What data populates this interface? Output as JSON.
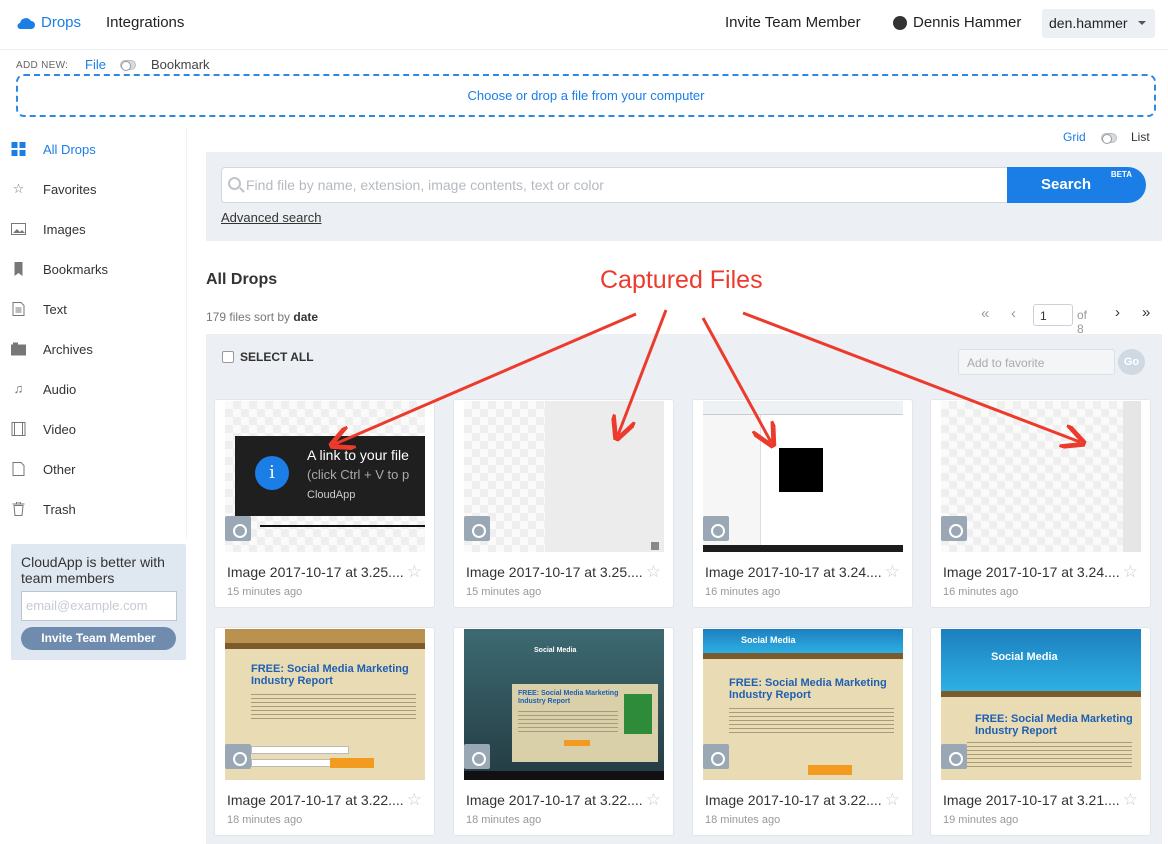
{
  "header": {
    "logo_label": "Drops",
    "nav_integrations": "Integrations",
    "invite_label": "Invite Team Member",
    "user_name": "Dennis Hammer",
    "account_label": "den.hammer"
  },
  "add_new": {
    "label": "ADD NEW:",
    "file_label": "File",
    "bookmark_label": "Bookmark",
    "dropzone_text": "Choose or drop a file from your computer"
  },
  "sidebar": {
    "items": [
      {
        "label": "All Drops",
        "icon": "grid-icon",
        "active": true
      },
      {
        "label": "Favorites",
        "icon": "star-icon"
      },
      {
        "label": "Images",
        "icon": "image-icon"
      },
      {
        "label": "Bookmarks",
        "icon": "bookmark-icon"
      },
      {
        "label": "Text",
        "icon": "text-file-icon"
      },
      {
        "label": "Archives",
        "icon": "archive-icon"
      },
      {
        "label": "Audio",
        "icon": "music-icon"
      },
      {
        "label": "Video",
        "icon": "film-icon"
      },
      {
        "label": "Other",
        "icon": "file-icon"
      },
      {
        "label": "Trash",
        "icon": "trash-icon"
      }
    ],
    "promo_text": "CloudApp is better with team members",
    "promo_email_placeholder": "email@example.com",
    "promo_button": "Invite Team Member"
  },
  "view": {
    "grid_label": "Grid",
    "list_label": "List"
  },
  "search": {
    "placeholder": "Find file by name, extension, image contents, text or color",
    "button_label": "Search",
    "badge": "BETA",
    "advanced_link": "Advanced search"
  },
  "main": {
    "title": "All Drops",
    "count_text": "179 files sort by",
    "sort_value": "date",
    "annotation": "Captured Files",
    "select_all": "SELECT ALL",
    "favorite_placeholder": "Add to favorite",
    "go_label": "Go"
  },
  "pagination": {
    "first": "«",
    "prev": "‹",
    "page": "1",
    "of_text": "of 8",
    "next": "›",
    "last": "»"
  },
  "toast": {
    "title": "A link to your file",
    "subtitle": "(click Ctrl + V to p",
    "app": "CloudApp"
  },
  "files": [
    {
      "name": "Image 2017-10-17 at 3.25....",
      "time": "15 minutes ago"
    },
    {
      "name": "Image 2017-10-17 at 3.25....",
      "time": "15 minutes ago"
    },
    {
      "name": "Image 2017-10-17 at 3.24....",
      "time": "16 minutes ago"
    },
    {
      "name": "Image 2017-10-17 at 3.24....",
      "time": "16 minutes ago"
    },
    {
      "name": "Image 2017-10-17 at 3.22....",
      "time": "18 minutes ago"
    },
    {
      "name": "Image 2017-10-17 at 3.22....",
      "time": "18 minutes ago"
    },
    {
      "name": "Image 2017-10-17 at 3.22....",
      "time": "18 minutes ago"
    },
    {
      "name": "Image 2017-10-17 at 3.21....",
      "time": "19 minutes ago"
    }
  ],
  "thumb_text": {
    "headline_1": "FREE: Social Media Marketing",
    "headline_2": "Industry Report",
    "brand": "Social Media"
  },
  "colors": {
    "accent": "#1a7ee6",
    "annotation": "#ec3b2c",
    "panel": "#eceff3"
  }
}
